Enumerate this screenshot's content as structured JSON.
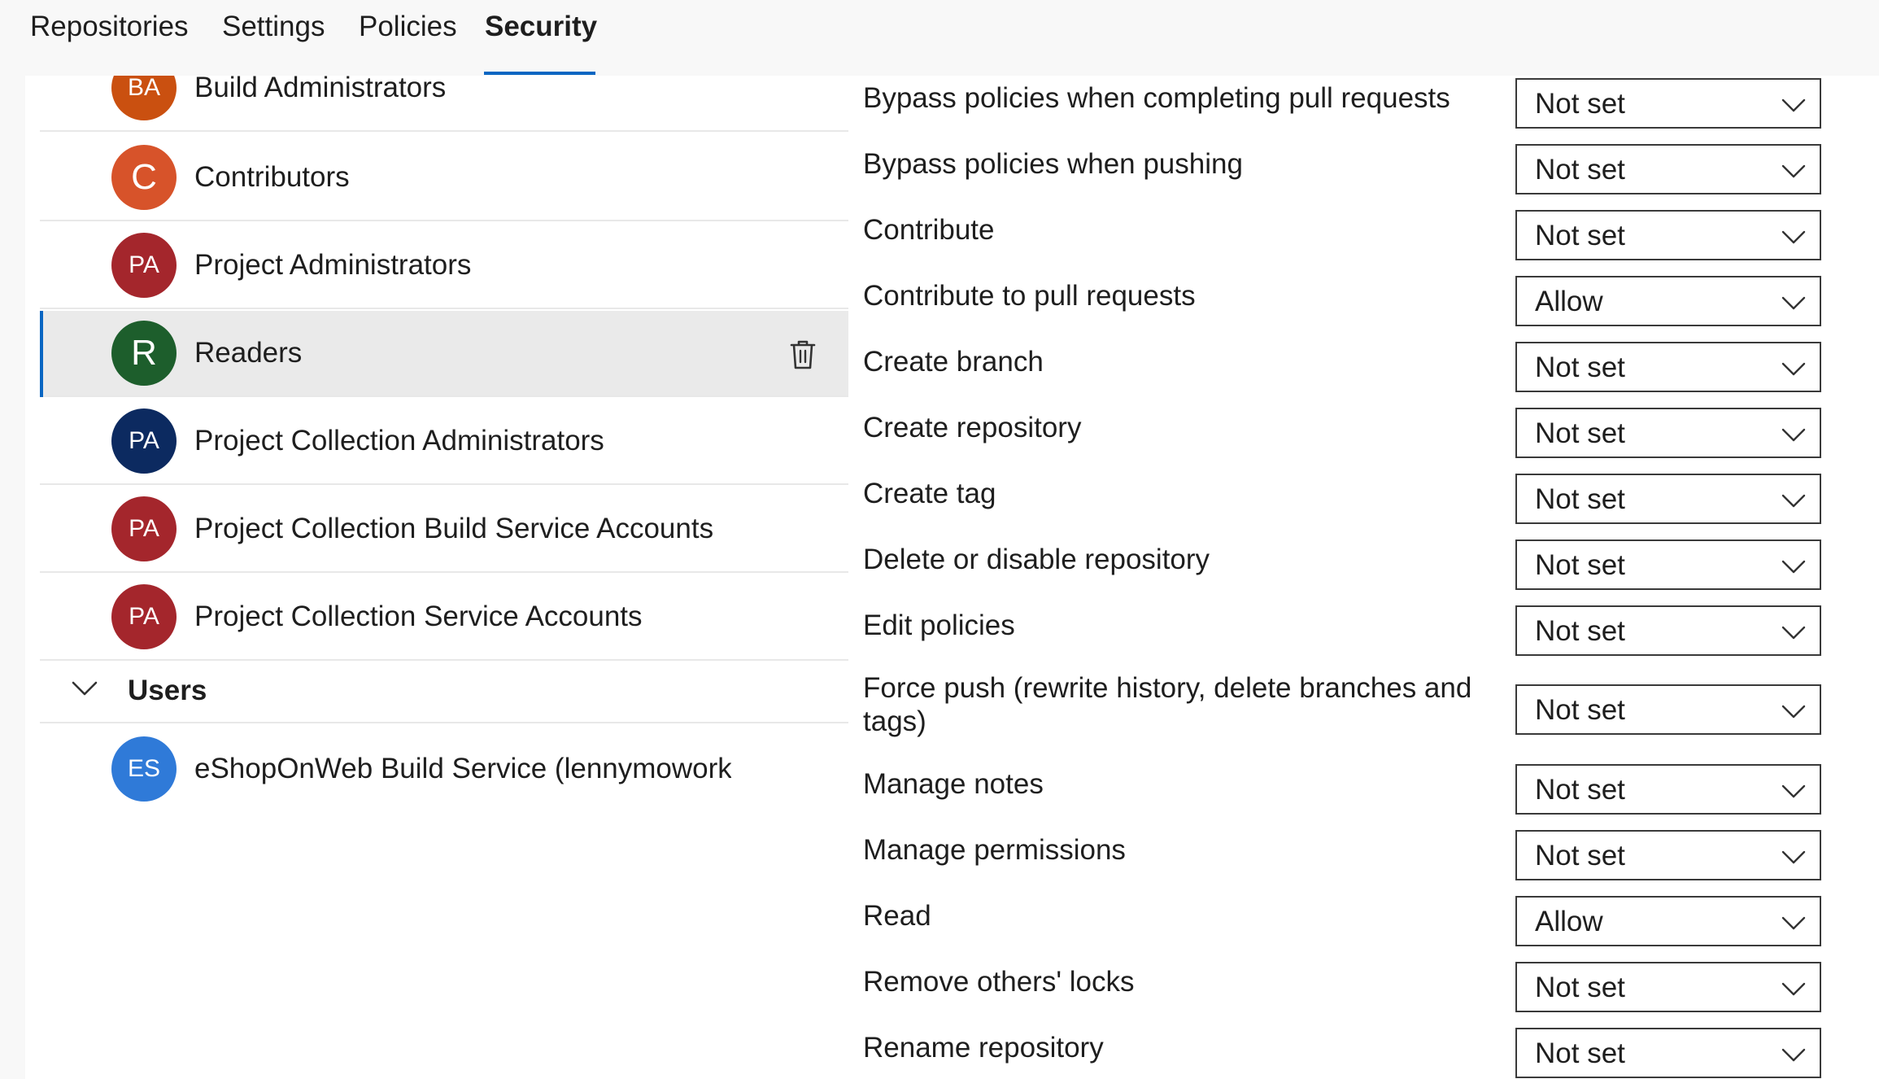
{
  "tabs": [
    {
      "label": "Repositories"
    },
    {
      "label": "Settings"
    },
    {
      "label": "Policies"
    },
    {
      "label": "Security"
    }
  ],
  "groups": [
    {
      "initials": "BA",
      "name": "Build Administrators",
      "color": "#ca5010"
    },
    {
      "initials": "C",
      "name": "Contributors",
      "color": "#d7532a"
    },
    {
      "initials": "PA",
      "name": "Project Administrators",
      "color": "#a4262c"
    },
    {
      "initials": "R",
      "name": "Readers",
      "color": "#1d5e2c"
    },
    {
      "initials": "PA",
      "name": "Project Collection Administrators",
      "color": "#0c2a60"
    },
    {
      "initials": "PA",
      "name": "Project Collection Build Service Accounts",
      "color": "#a4262c"
    },
    {
      "initials": "PA",
      "name": "Project Collection Service Accounts",
      "color": "#a4262c"
    }
  ],
  "selected_group": "Readers",
  "users_section": {
    "title": "Users"
  },
  "users": [
    {
      "initials": "ES",
      "name": "eShopOnWeb Build Service (lennymowork",
      "color": "#2f7ad8"
    }
  ],
  "permissions": [
    {
      "label": "Bypass policies when completing pull requests",
      "value": "Not set"
    },
    {
      "label": "Bypass policies when pushing",
      "value": "Not set"
    },
    {
      "label": "Contribute",
      "value": "Not set"
    },
    {
      "label": "Contribute to pull requests",
      "value": "Allow"
    },
    {
      "label": "Create branch",
      "value": "Not set"
    },
    {
      "label": "Create repository",
      "value": "Not set"
    },
    {
      "label": "Create tag",
      "value": "Not set"
    },
    {
      "label": "Delete or disable repository",
      "value": "Not set"
    },
    {
      "label": "Edit policies",
      "value": "Not set"
    },
    {
      "label": "Force push (rewrite history, delete branches and tags)",
      "value": "Not set"
    },
    {
      "label": "Manage notes",
      "value": "Not set"
    },
    {
      "label": "Manage permissions",
      "value": "Not set"
    },
    {
      "label": "Read",
      "value": "Allow"
    },
    {
      "label": "Remove others' locks",
      "value": "Not set"
    },
    {
      "label": "Rename repository",
      "value": "Not set"
    }
  ],
  "accent_color": "#0a66c2"
}
